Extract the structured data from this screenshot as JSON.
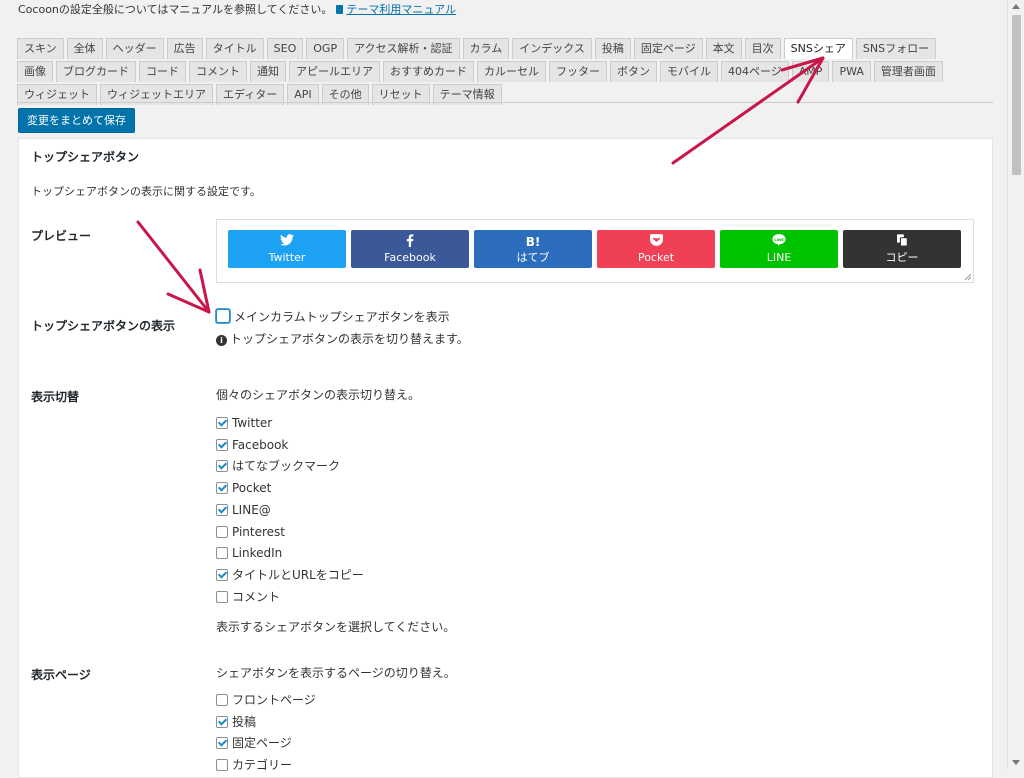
{
  "notice": {
    "text": "Cocoonの設定全般についてはマニュアルを参照してください。",
    "link": "テーマ利用マニュアル"
  },
  "tabs": {
    "row1": [
      "スキン",
      "全体",
      "ヘッダー",
      "広告",
      "タイトル",
      "SEO",
      "OGP",
      "アクセス解析・認証",
      "カラム",
      "インデックス",
      "投稿",
      "固定ページ",
      "本文",
      "目次",
      "SNSシェア",
      "SNSフォロー"
    ],
    "row2": [
      "画像",
      "ブログカード",
      "コード",
      "コメント",
      "通知",
      "アピールエリア",
      "おすすめカード",
      "カルーセル",
      "フッター",
      "ボタン",
      "モバイル",
      "404ページ",
      "AMP",
      "PWA",
      "管理者画面"
    ],
    "row3": [
      "ウィジェット",
      "ウィジェットエリア",
      "エディター",
      "API",
      "その他",
      "リセット",
      "テーマ情報"
    ],
    "active": "SNSシェア"
  },
  "save_button": "変更をまとめて保存",
  "section": {
    "title": "トップシェアボタン",
    "description": "トップシェアボタンの表示に関する設定です。"
  },
  "preview": {
    "label": "プレビュー",
    "buttons": [
      {
        "name": "twitter",
        "icon": "twitter-bird",
        "label": "Twitter",
        "color": "#1da1f2"
      },
      {
        "name": "facebook",
        "icon": "facebook-f",
        "label": "Facebook",
        "color": "#3b5998"
      },
      {
        "name": "hatebu",
        "icon": "B!",
        "label": "はてブ",
        "color": "#2c6ebd"
      },
      {
        "name": "pocket",
        "icon": "pocket",
        "label": "Pocket",
        "color": "#ef4056"
      },
      {
        "name": "line",
        "icon": "line-bubble",
        "label": "LINE",
        "color": "#00c300"
      },
      {
        "name": "copy",
        "icon": "copy",
        "label": "コピー",
        "color": "#333333"
      }
    ]
  },
  "display": {
    "label": "トップシェアボタンの表示",
    "checkbox_label": "メインカラムトップシェアボタンを表示",
    "checked": false,
    "hint": "トップシェアボタンの表示を切り替えます。"
  },
  "toggle": {
    "label": "表示切替",
    "intro": "個々のシェアボタンの表示切り替え。",
    "items": [
      {
        "label": "Twitter",
        "checked": true
      },
      {
        "label": "Facebook",
        "checked": true
      },
      {
        "label": "はてなブックマーク",
        "checked": true
      },
      {
        "label": "Pocket",
        "checked": true
      },
      {
        "label": "LINE@",
        "checked": true
      },
      {
        "label": "Pinterest",
        "checked": false
      },
      {
        "label": "LinkedIn",
        "checked": false
      },
      {
        "label": "タイトルとURLをコピー",
        "checked": true
      },
      {
        "label": "コメント",
        "checked": false
      }
    ],
    "note": "表示するシェアボタンを選択してください。"
  },
  "pages": {
    "label": "表示ページ",
    "intro": "シェアボタンを表示するページの切り替え。",
    "items": [
      {
        "label": "フロントページ",
        "checked": false
      },
      {
        "label": "投稿",
        "checked": true
      },
      {
        "label": "固定ページ",
        "checked": true
      },
      {
        "label": "カテゴリー",
        "checked": false
      }
    ]
  },
  "colors": {
    "accent": "#0073aa",
    "annotation_arrow": "#c8164b"
  }
}
